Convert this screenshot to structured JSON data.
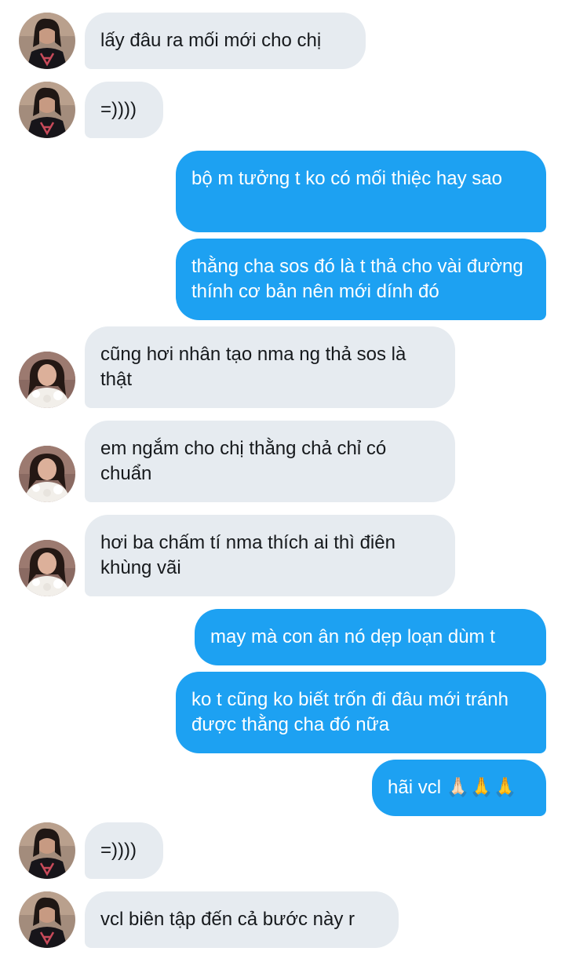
{
  "thread": {
    "messages": [
      {
        "side": "in",
        "avatar": "girl-black-shirt-avatar",
        "text": "lấy đâu ra mối mới cho chị"
      },
      {
        "side": "in",
        "avatar": "girl-black-shirt-avatar",
        "text": "=))))"
      },
      {
        "side": "out",
        "text": "bộ m tưởng t ko có mối thiệc hay sao"
      },
      {
        "side": "out",
        "text": "thằng cha sos đó là t thả cho vài đường thính cơ bản nên mới dính đó"
      },
      {
        "side": "in",
        "avatar": "girl-white-top-avatar",
        "text": "cũng hơi nhân tạo nma ng thả sos là thật"
      },
      {
        "side": "in",
        "avatar": "girl-white-top-avatar",
        "text": "em ngắm cho chị thằng chả chỉ có chuẩn"
      },
      {
        "side": "in",
        "avatar": "girl-white-top-avatar",
        "text": "hơi ba chấm tí nma thích ai thì điên khùng vãi"
      },
      {
        "side": "out",
        "text": "may mà con ân nó dẹp loạn dùm t"
      },
      {
        "side": "out",
        "text": "ko t cũng ko biết trốn đi đâu mới tránh được thằng cha đó nữa"
      },
      {
        "side": "out",
        "text": "hãi vcl 🙏🏻🙏🙏"
      },
      {
        "side": "in",
        "avatar": "girl-black-shirt-avatar",
        "text": "=))))"
      },
      {
        "side": "in",
        "avatar": "girl-black-shirt-avatar",
        "text": "vcl biên tập đến cả bước này r"
      }
    ]
  },
  "colors": {
    "incoming_bubble": "#e6ebf0",
    "outgoing_bubble": "#1da1f2",
    "incoming_text": "#16191c",
    "outgoing_text": "#ffffff"
  }
}
